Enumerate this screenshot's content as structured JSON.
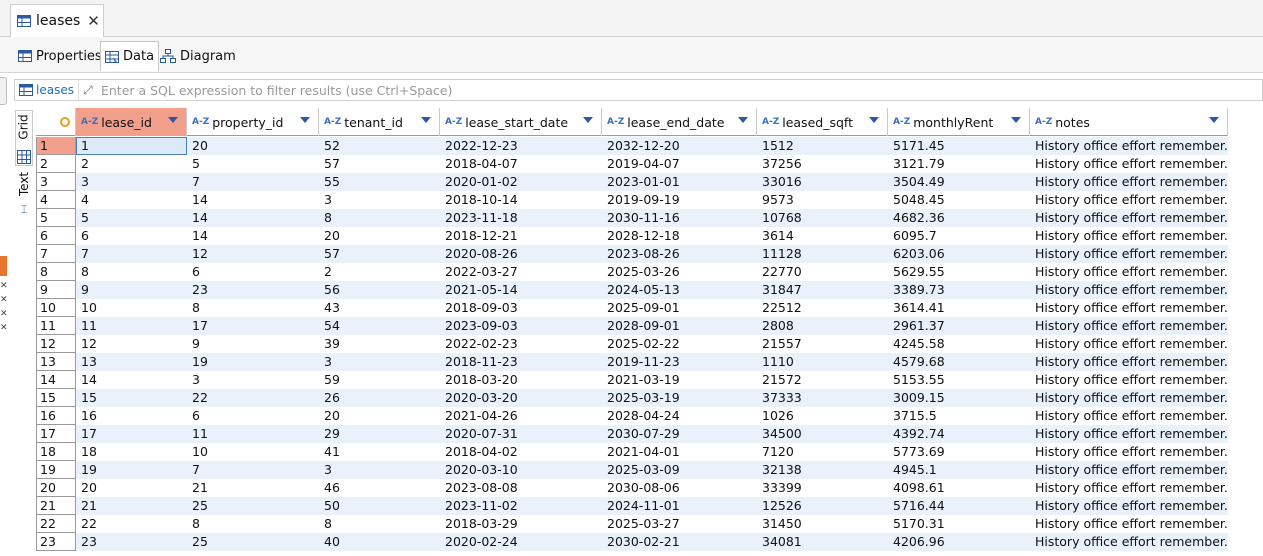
{
  "editor_tab": {
    "title": "leases",
    "close_icon": "close-icon",
    "icon": "table-icon"
  },
  "subtabs": [
    {
      "label": "Properties",
      "icon": "table-properties-icon",
      "active": false
    },
    {
      "label": "Data",
      "icon": "data-icon",
      "active": true
    },
    {
      "label": "Diagram",
      "icon": "diagram-icon",
      "active": false
    }
  ],
  "filter": {
    "table_label": "leases",
    "placeholder": "Enter a SQL expression to filter results (use Ctrl+Space)"
  },
  "side_tabs": {
    "grid": "Grid",
    "text": "Text"
  },
  "colors": {
    "selected_header": "#f2a08c",
    "alt_row": "#e9f1fb",
    "accent": "#2a5aa0",
    "orange": "#e8742e"
  },
  "columns": [
    {
      "key": "lease_id",
      "label": "lease_id"
    },
    {
      "key": "property_id",
      "label": "property_id"
    },
    {
      "key": "tenant_id",
      "label": "tenant_id"
    },
    {
      "key": "lease_start_date",
      "label": "lease_start_date"
    },
    {
      "key": "lease_end_date",
      "label": "lease_end_date"
    },
    {
      "key": "leased_sqft",
      "label": "leased_sqft"
    },
    {
      "key": "monthlyRent",
      "label": "monthlyRent"
    },
    {
      "key": "notes",
      "label": "notes"
    }
  ],
  "rows": [
    [
      "1",
      "1",
      "20",
      "52",
      "2022-12-23",
      "2032-12-20",
      "1512",
      "5171.45",
      "History office effort remember."
    ],
    [
      "2",
      "2",
      "5",
      "57",
      "2018-04-07",
      "2019-04-07",
      "37256",
      "3121.79",
      "History office effort remember."
    ],
    [
      "3",
      "3",
      "7",
      "55",
      "2020-01-02",
      "2023-01-01",
      "33016",
      "3504.49",
      "History office effort remember."
    ],
    [
      "4",
      "4",
      "14",
      "3",
      "2018-10-14",
      "2019-09-19",
      "9573",
      "5048.45",
      "History office effort remember."
    ],
    [
      "5",
      "5",
      "14",
      "8",
      "2023-11-18",
      "2030-11-16",
      "10768",
      "4682.36",
      "History office effort remember."
    ],
    [
      "6",
      "6",
      "14",
      "20",
      "2018-12-21",
      "2028-12-18",
      "3614",
      "6095.7",
      "History office effort remember."
    ],
    [
      "7",
      "7",
      "12",
      "57",
      "2020-08-26",
      "2023-08-26",
      "11128",
      "6203.06",
      "History office effort remember."
    ],
    [
      "8",
      "8",
      "6",
      "2",
      "2022-03-27",
      "2025-03-26",
      "22770",
      "5629.55",
      "History office effort remember."
    ],
    [
      "9",
      "9",
      "23",
      "56",
      "2021-05-14",
      "2024-05-13",
      "31847",
      "3389.73",
      "History office effort remember."
    ],
    [
      "10",
      "10",
      "8",
      "43",
      "2018-09-03",
      "2025-09-01",
      "22512",
      "3614.41",
      "History office effort remember."
    ],
    [
      "11",
      "11",
      "17",
      "54",
      "2023-09-03",
      "2028-09-01",
      "2808",
      "2961.37",
      "History office effort remember."
    ],
    [
      "12",
      "12",
      "9",
      "39",
      "2022-02-23",
      "2025-02-22",
      "21557",
      "4245.58",
      "History office effort remember."
    ],
    [
      "13",
      "13",
      "19",
      "3",
      "2018-11-23",
      "2019-11-23",
      "1110",
      "4579.68",
      "History office effort remember."
    ],
    [
      "14",
      "14",
      "3",
      "59",
      "2018-03-20",
      "2021-03-19",
      "21572",
      "5153.55",
      "History office effort remember."
    ],
    [
      "15",
      "15",
      "22",
      "26",
      "2020-03-20",
      "2025-03-19",
      "37333",
      "3009.15",
      "History office effort remember."
    ],
    [
      "16",
      "16",
      "6",
      "20",
      "2021-04-26",
      "2028-04-24",
      "1026",
      "3715.5",
      "History office effort remember."
    ],
    [
      "17",
      "17",
      "11",
      "29",
      "2020-07-31",
      "2030-07-29",
      "34500",
      "4392.74",
      "History office effort remember."
    ],
    [
      "18",
      "18",
      "10",
      "41",
      "2018-04-02",
      "2021-04-01",
      "7120",
      "5773.69",
      "History office effort remember."
    ],
    [
      "19",
      "19",
      "7",
      "3",
      "2020-03-10",
      "2025-03-09",
      "32138",
      "4945.1",
      "History office effort remember."
    ],
    [
      "20",
      "20",
      "21",
      "46",
      "2023-08-08",
      "2030-08-06",
      "33399",
      "4098.61",
      "History office effort remember."
    ],
    [
      "21",
      "21",
      "25",
      "50",
      "2023-11-02",
      "2024-11-01",
      "12526",
      "5716.44",
      "History office effort remember."
    ],
    [
      "22",
      "22",
      "8",
      "8",
      "2018-03-29",
      "2025-03-27",
      "31450",
      "5170.31",
      "History office effort remember."
    ],
    [
      "23",
      "23",
      "25",
      "40",
      "2020-02-24",
      "2030-02-21",
      "34081",
      "4206.96",
      "History office effort remember."
    ]
  ]
}
